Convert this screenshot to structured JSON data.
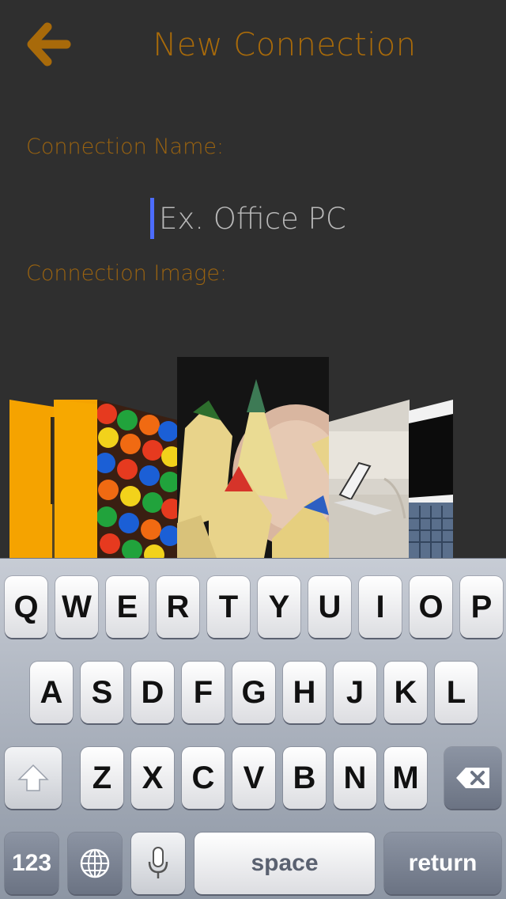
{
  "header": {
    "title": "New Connection",
    "back_icon": "arrow-left-icon"
  },
  "form": {
    "name_label": "Connection Name:",
    "name_placeholder": "Ex. Office PC",
    "name_value": "",
    "image_label": "Connection Image:"
  },
  "carousel": {
    "items": [
      {
        "name": "orange-logo",
        "selected": false
      },
      {
        "name": "candies",
        "selected": false
      },
      {
        "name": "colored-pencils",
        "selected": true
      },
      {
        "name": "laptop-on-couch",
        "selected": false
      },
      {
        "name": "laptop-keyboard",
        "selected": false
      }
    ]
  },
  "keyboard": {
    "row1": [
      "Q",
      "W",
      "E",
      "R",
      "T",
      "Y",
      "U",
      "I",
      "O",
      "P"
    ],
    "row2": [
      "A",
      "S",
      "D",
      "F",
      "G",
      "H",
      "J",
      "K",
      "L"
    ],
    "row3": [
      "Z",
      "X",
      "C",
      "V",
      "B",
      "N",
      "M"
    ],
    "numbers_label": "123",
    "space_label": "space",
    "return_label": "return",
    "shift_icon": "shift-arrow-icon",
    "delete_icon": "backspace-icon",
    "globe_icon": "globe-icon",
    "mic_icon": "microphone-icon"
  },
  "colors": {
    "background": "#2f2f2f",
    "accent": "#a86a0a",
    "caret": "#4c6cff"
  }
}
